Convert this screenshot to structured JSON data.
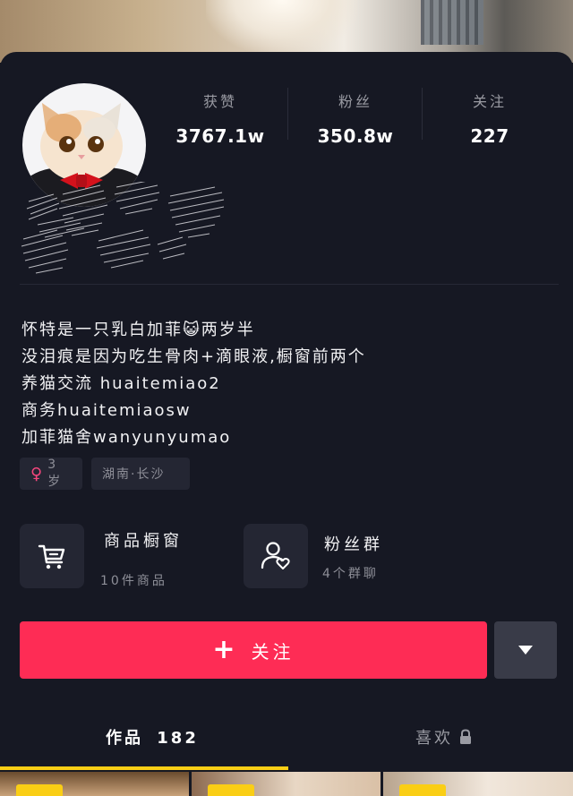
{
  "stats": [
    {
      "label": "获赞",
      "value": "3767.1w"
    },
    {
      "label": "粉丝",
      "value": "350.8w"
    },
    {
      "label": "关注",
      "value": "227"
    }
  ],
  "bio": {
    "lines": [
      "怀特是一只乳白加菲😺两岁半",
      "没泪痕是因为吃生骨肉+滴眼液,橱窗前两个",
      "养猫交流 huaitemiao2",
      "商务huaitemiaosw",
      "加菲猫舍wanyunyumao"
    ]
  },
  "tags": {
    "age": "3岁",
    "location": "湖南·长沙"
  },
  "cards": {
    "shop": {
      "title": "商品橱窗",
      "subtitle": "10件商品",
      "icon": "shopping-cart-icon"
    },
    "fan_group": {
      "title": "粉丝群",
      "subtitle": "4个群聊",
      "icon": "group-chat-icon"
    }
  },
  "actions": {
    "follow_label": "关注",
    "more_icon": "caret-down-icon"
  },
  "tabs": {
    "works_label": "作品",
    "works_count": "182",
    "likes_label": "喜欢",
    "likes_icon": "lock-icon"
  },
  "colors": {
    "background": "#161823",
    "accent": "#fe2c55",
    "tab_indicator": "#face15",
    "female": "#f5467d"
  }
}
